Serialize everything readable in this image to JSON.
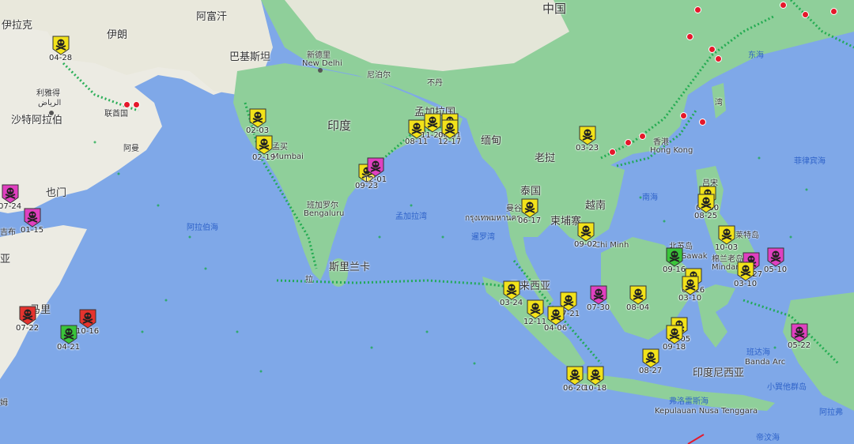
{
  "colors": {
    "water": "#7fa8e8",
    "land": "#8fcf9a",
    "land_light": "#b9e2be",
    "desert": "#ecebe3",
    "mountain": "#a9cfa6",
    "traffic": "#18a84a",
    "marker_yellow": "#f2e21a",
    "marker_magenta": "#e040c0",
    "marker_red": "#e5332e",
    "marker_green": "#3ac43a",
    "port_red": "#e5182b"
  },
  "labels": {
    "iraq": "伊拉克",
    "iran": "伊朗",
    "afghanistan": "阿富汗",
    "china": "中国",
    "pakistan": "巴基斯坦",
    "newdelhi_cn": "新德里",
    "newdelhi_en": "New Delhi",
    "nepal": "尼泊尔",
    "bhutan": "不丹",
    "riyadh_cn": "利雅得",
    "riyadh_ar": "الرياض",
    "saudi": "沙特阿拉伯",
    "uae": "联酋国",
    "oman": "阿曼",
    "india": "印度",
    "bangladesh": "孟加拉国",
    "myanmar": "缅甸",
    "laos": "老挝",
    "mumbai_cn": "孟买",
    "mumbai_en": "Mumbai",
    "yemen": "也门",
    "djibouti": "吉布",
    "ethiopia": "亚",
    "somalia": "马里",
    "arabian_sea": "阿拉伯海",
    "bengaluru_cn": "班加罗尔",
    "bengaluru_en": "Bengaluru",
    "bay_bengal": "孟加拉湾",
    "thailand": "泰国",
    "bangkok_th": "กรุงเทพมหานคร",
    "bangkok_cn": "曼谷",
    "vietnam": "越南",
    "cambodia": "柬埔寨",
    "hochiminh": "Chi Minh",
    "gulf_thailand": "暹罗湾",
    "hongkong_cn": "香港",
    "hongkong_en": "Hong Kong",
    "philippines": "吕宋",
    "south_sea": "南海",
    "phil_sea": "菲律宾海",
    "taiwan": "湾",
    "sri_lanka": "斯里兰卡",
    "malaysia": "马来西亚",
    "srilanka_sea": "拉",
    "brunei": "Sawak",
    "mindanao": "Mindan",
    "leyte": "莱特岛",
    "mindanao_cn": "棉兰老岛",
    "indonesia": "印度尼西亚",
    "banda_sea": "班达海",
    "banda_arc": "Banda Arc",
    "nusa_cn": "小巽他群岛",
    "nusa_en": "Kepulauan Nusa Tenggara",
    "arafura": "阿拉弗",
    "timor": "帝汶海",
    "flores": "弗洛雷斯海",
    "somali_bottom": "姆",
    "east_china_sea": "东海",
    "luzon2": "北苏岛"
  },
  "markers": [
    {
      "date": "04-28",
      "color": "yellow"
    },
    {
      "date": "02-03",
      "color": "yellow"
    },
    {
      "date": "02-19",
      "color": "yellow"
    },
    {
      "date": "07-24",
      "color": "magenta"
    },
    {
      "date": "01-15",
      "color": "magenta"
    },
    {
      "date": "09-23",
      "color": "yellow"
    },
    {
      "date": "12-01",
      "color": "magenta"
    },
    {
      "date": "08-11",
      "color": "yellow"
    },
    {
      "date": "11-26",
      "color": "yellow"
    },
    {
      "date": "06-01",
      "color": "yellow"
    },
    {
      "date": "12-17",
      "color": "yellow"
    },
    {
      "date": "03-23",
      "color": "yellow"
    },
    {
      "date": "06-17",
      "color": "yellow"
    },
    {
      "date": "09-02",
      "color": "yellow"
    },
    {
      "date": "09-30",
      "color": "yellow"
    },
    {
      "date": "08-25",
      "color": "yellow"
    },
    {
      "date": "10-03",
      "color": "yellow"
    },
    {
      "date": "08-27",
      "color": "magenta"
    },
    {
      "date": "03-10",
      "color": "yellow"
    },
    {
      "date": "05-10",
      "color": "magenta"
    },
    {
      "date": "09-16",
      "color": "green"
    },
    {
      "date": "01-16",
      "color": "yellow"
    },
    {
      "date": "03-10",
      "color": "yellow"
    },
    {
      "date": "07-22",
      "color": "red"
    },
    {
      "date": "10-16",
      "color": "red"
    },
    {
      "date": "04-21",
      "color": "green"
    },
    {
      "date": "03-24",
      "color": "yellow"
    },
    {
      "date": "12-11",
      "color": "yellow"
    },
    {
      "date": "07-21",
      "color": "yellow"
    },
    {
      "date": "04-06",
      "color": "yellow"
    },
    {
      "date": "07-30",
      "color": "magenta"
    },
    {
      "date": "08-04",
      "color": "yellow"
    },
    {
      "date": "01-05",
      "color": "yellow"
    },
    {
      "date": "09-18",
      "color": "yellow"
    },
    {
      "date": "05-22",
      "color": "magenta"
    },
    {
      "date": "08-27",
      "color": "yellow"
    },
    {
      "date": "06-20",
      "color": "yellow"
    },
    {
      "date": "10-18",
      "color": "yellow"
    }
  ]
}
